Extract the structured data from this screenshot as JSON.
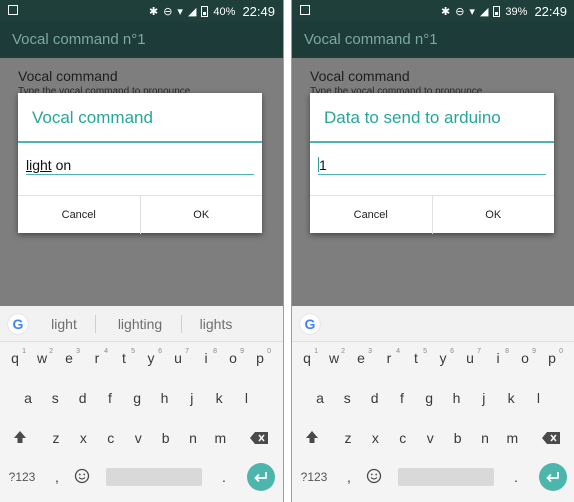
{
  "screens": [
    {
      "status": {
        "battery": "40%",
        "time": "22:49"
      },
      "app_title": "Vocal command n°1",
      "bg_title": "Vocal command",
      "bg_subtitle": "Type the vocal command to pronounce",
      "dialog": {
        "title": "Vocal command",
        "value_underlined": "light",
        "value_rest": " on",
        "cancel": "Cancel",
        "ok": "OK"
      },
      "suggestions": [
        "light",
        "lighting",
        "lights"
      ]
    },
    {
      "status": {
        "battery": "39%",
        "time": "22:49"
      },
      "app_title": "Vocal command n°1",
      "bg_title": "Vocal command",
      "bg_subtitle": "Type the vocal command to pronounce",
      "dialog": {
        "title": "Data to send to arduino",
        "value": "1",
        "cancel": "Cancel",
        "ok": "OK"
      },
      "suggestions": []
    }
  ],
  "keyboard": {
    "row1": [
      "q",
      "w",
      "e",
      "r",
      "t",
      "y",
      "u",
      "i",
      "o",
      "p"
    ],
    "row1_hints": [
      "1",
      "2",
      "3",
      "4",
      "5",
      "6",
      "7",
      "8",
      "9",
      "0"
    ],
    "row2": [
      "a",
      "s",
      "d",
      "f",
      "g",
      "h",
      "j",
      "k",
      "l"
    ],
    "row3": [
      "z",
      "x",
      "c",
      "v",
      "b",
      "n",
      "m"
    ],
    "symbols_label": "?123",
    "period": ".",
    "comma": ",",
    "google_label": "G",
    "icons": {
      "shift": "shift-icon",
      "delete": "backspace-icon",
      "emoji": "emoji-icon",
      "enter": "enter-icon"
    }
  },
  "colors": {
    "accent": "#26a69a",
    "status_bar": "#1f3f3a",
    "app_bar": "#1d3b38",
    "dim_overlay": "#7e7e7e"
  }
}
